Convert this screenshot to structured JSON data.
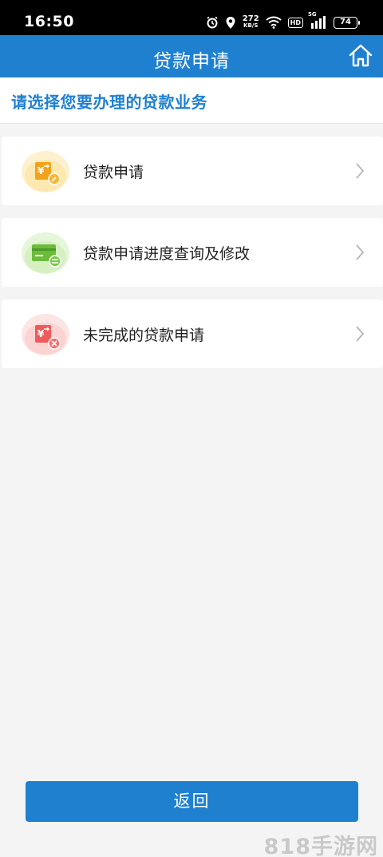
{
  "status_bar": {
    "time": "16:50",
    "net_speed_value": "272",
    "net_speed_unit": "KB/S",
    "hd_badge": "HD",
    "signal_label": "5G",
    "battery": "74"
  },
  "header": {
    "title": "贷款申请"
  },
  "subheader": {
    "text": "请选择您要办理的贷款业务"
  },
  "menu": {
    "items": [
      {
        "label": "贷款申请",
        "icon": "loan-apply-icon"
      },
      {
        "label": "贷款申请进度查询及修改",
        "icon": "loan-card-edit-icon"
      },
      {
        "label": "未完成的贷款申请",
        "icon": "loan-cancel-icon"
      }
    ]
  },
  "footer": {
    "back_label": "返回"
  },
  "watermark": "818手游网",
  "colors": {
    "primary": "#1f80d0",
    "background": "#f4f4f4"
  }
}
